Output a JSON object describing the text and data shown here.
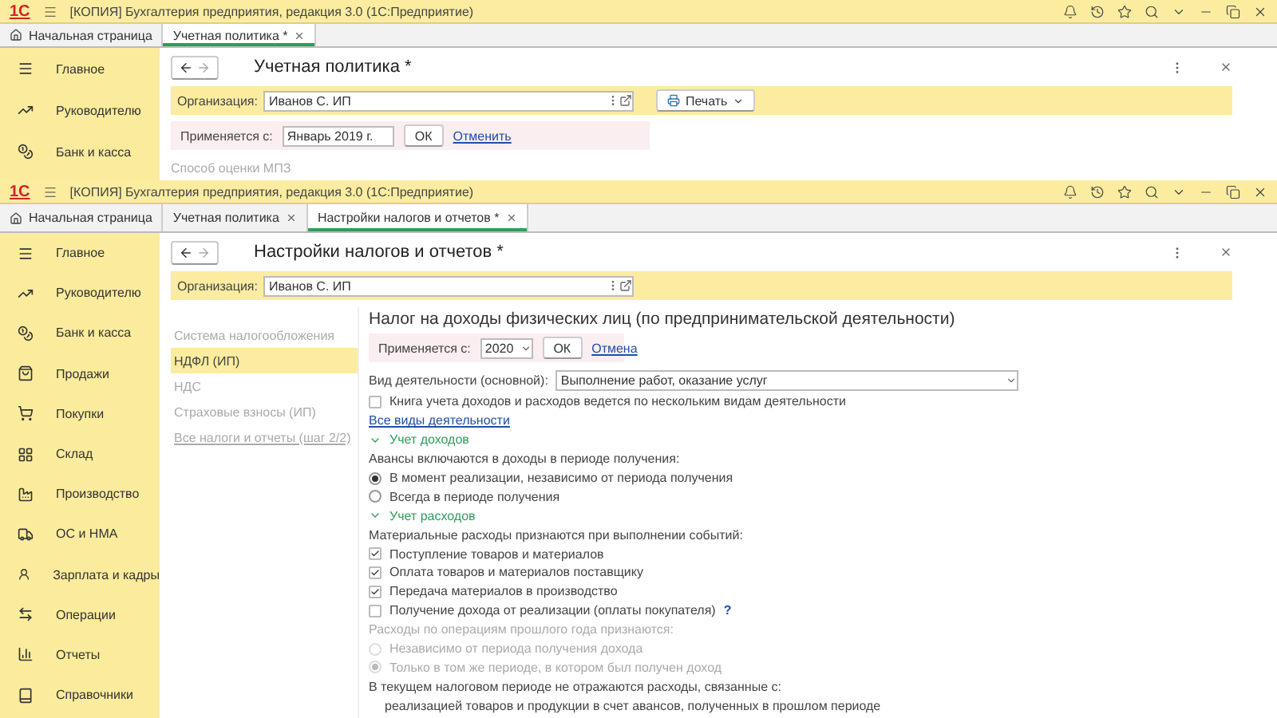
{
  "back_window": {
    "logo": "1С",
    "title": "[КОПИЯ] Бухгалтерия предприятия, редакция 3.0 (1С:Предприятие)",
    "tabs": [
      {
        "kind": "home",
        "label": "Начальная страница",
        "selected": false
      },
      {
        "kind": "document",
        "label": "Учетная политика *",
        "selected": true
      }
    ],
    "sidebar": {
      "items": [
        {
          "label": "Главное"
        },
        {
          "label": "Руководителю"
        },
        {
          "label": "Банк и касса"
        }
      ]
    },
    "form": {
      "title": "Учетная политика *",
      "organization": {
        "label": "Организация:",
        "value": "Иванов С. ИП"
      },
      "print_button": "Печать",
      "applies": {
        "label": "Применяется с:",
        "value": "Январь 2019 г.",
        "ok": "ОК",
        "cancel": "Отменить"
      },
      "next_caption": "Способ оценки МПЗ"
    }
  },
  "front_window": {
    "logo": "1С",
    "title": "[КОПИЯ] Бухгалтерия предприятия, редакция 3.0 (1С:Предприятие)",
    "tabs": [
      {
        "kind": "home",
        "label": "Начальная страница",
        "selected": false
      },
      {
        "kind": "document",
        "label": "Учетная политика",
        "selected": false
      },
      {
        "kind": "document",
        "label": "Настройки налогов и отчетов *",
        "selected": true
      }
    ],
    "sidebar": {
      "items": [
        {
          "label": "Главное"
        },
        {
          "label": "Руководителю"
        },
        {
          "label": "Банк и касса"
        },
        {
          "label": "Продажи"
        },
        {
          "label": "Покупки"
        },
        {
          "label": "Склад"
        },
        {
          "label": "Производство"
        },
        {
          "label": "ОС и НМА"
        },
        {
          "label": "Зарплата и кадры"
        },
        {
          "label": "Операции"
        },
        {
          "label": "Отчеты"
        },
        {
          "label": "Справочники"
        }
      ]
    },
    "form": {
      "title": "Настройки налогов и отчетов *",
      "organization": {
        "label": "Организация:",
        "value": "Иванов С. ИП"
      },
      "nav": [
        {
          "kind": "item",
          "label": "Система налогообложения",
          "selected": false
        },
        {
          "kind": "item",
          "label": "НДФЛ (ИП)",
          "selected": true
        },
        {
          "kind": "item",
          "label": "НДС",
          "selected": false
        },
        {
          "kind": "item",
          "label": "Страховые взносы (ИП)",
          "selected": false
        },
        {
          "kind": "link",
          "label": "Все налоги и отчеты (шаг 2/2)",
          "selected": false
        }
      ],
      "section_title": "Налог на доходы физических лиц (по предпринимательской деятельности)",
      "applies": {
        "label": "Применяется с:",
        "value": "2020",
        "ok": "ОК",
        "cancel": "Отмена"
      },
      "rows": [
        {
          "kind": "select",
          "label": "Вид деятельности (основной):",
          "value": "Выполнение работ, оказание услуг"
        },
        {
          "kind": "checkbox",
          "label": "Книга учета доходов и расходов ведется по нескольким видам деятельности",
          "checked": false,
          "disabled": false
        },
        {
          "kind": "link",
          "label": "Все виды деятельности"
        },
        {
          "kind": "section",
          "label": "Учет доходов",
          "expanded": true
        },
        {
          "kind": "caption",
          "label": "Авансы включаются в доходы в периоде получения:",
          "disabled": false
        },
        {
          "kind": "radio",
          "label": "В момент реализации, независимо от периода получения",
          "selected": true,
          "disabled": false
        },
        {
          "kind": "radio",
          "label": "Всегда в периоде получения",
          "selected": false,
          "disabled": false
        },
        {
          "kind": "section",
          "label": "Учет расходов",
          "expanded": true
        },
        {
          "kind": "caption",
          "label": "Материальные расходы признаются при выполнении событий:",
          "disabled": false
        },
        {
          "kind": "checkbox",
          "label": "Поступление товаров и материалов",
          "checked": true,
          "disabled": false
        },
        {
          "kind": "checkbox",
          "label": "Оплата товаров и материалов поставщику",
          "checked": true,
          "disabled": false
        },
        {
          "kind": "checkbox",
          "label": "Передача материалов в производство",
          "checked": true,
          "disabled": false
        },
        {
          "kind": "checkbox",
          "label": "Получение дохода от реализации (оплаты покупателя)",
          "checked": false,
          "disabled": false,
          "help": "?"
        },
        {
          "kind": "caption",
          "label": "Расходы по операциям прошлого года признаются:",
          "disabled": true
        },
        {
          "kind": "radio",
          "label": "Независимо от периода получения дохода",
          "selected": false,
          "disabled": true
        },
        {
          "kind": "radio",
          "label": "Только в том же периоде, в котором был получен доход",
          "selected": true,
          "disabled": true
        },
        {
          "kind": "caption",
          "label": "В текущем налоговом периоде не отражаются расходы, связанные с:",
          "disabled": false
        },
        {
          "kind": "note",
          "label": "реализацией товаров и продукции в счет авансов, полученных в прошлом периоде"
        }
      ]
    }
  }
}
